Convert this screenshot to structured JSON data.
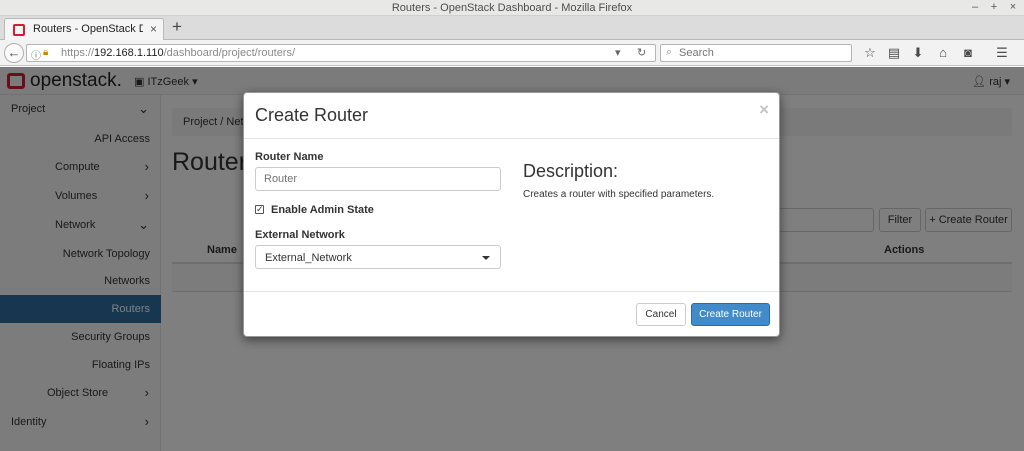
{
  "window": {
    "title": "Routers - OpenStack Dashboard - Mozilla Firefox"
  },
  "browser": {
    "tab_title": "Routers - OpenStack Dashb",
    "url_prefix": "https://",
    "url_host": "192.168.1.110",
    "url_path": "/dashboard/project/routers/",
    "search_placeholder": "Search"
  },
  "header": {
    "logo": "openstack.",
    "project": "ITzGeek",
    "user": "raj"
  },
  "sidebar": {
    "items": [
      {
        "label": "Project"
      },
      {
        "label": "API Access"
      },
      {
        "label": "Compute"
      },
      {
        "label": "Volumes"
      },
      {
        "label": "Network"
      },
      {
        "label": "Network Topology"
      },
      {
        "label": "Networks"
      },
      {
        "label": "Routers"
      },
      {
        "label": "Security Groups"
      },
      {
        "label": "Floating IPs"
      },
      {
        "label": "Object Store"
      },
      {
        "label": "Identity"
      }
    ]
  },
  "main": {
    "breadcrumb": "Project / Netw",
    "page_title": "Routers",
    "filter_label": "Filter",
    "create_label": "Create Router",
    "columns": {
      "name": "Name",
      "actions": "Actions"
    }
  },
  "modal": {
    "title": "Create Router",
    "close": "×",
    "router_name_label": "Router Name",
    "router_name_placeholder": "Router",
    "admin_state_label": "Enable Admin State",
    "admin_state_checked": true,
    "external_network_label": "External Network",
    "external_network_value": "External_Network",
    "description_title": "Description:",
    "description_text": "Creates a router with specified parameters.",
    "cancel_label": "Cancel",
    "submit_label": "Create Router"
  }
}
